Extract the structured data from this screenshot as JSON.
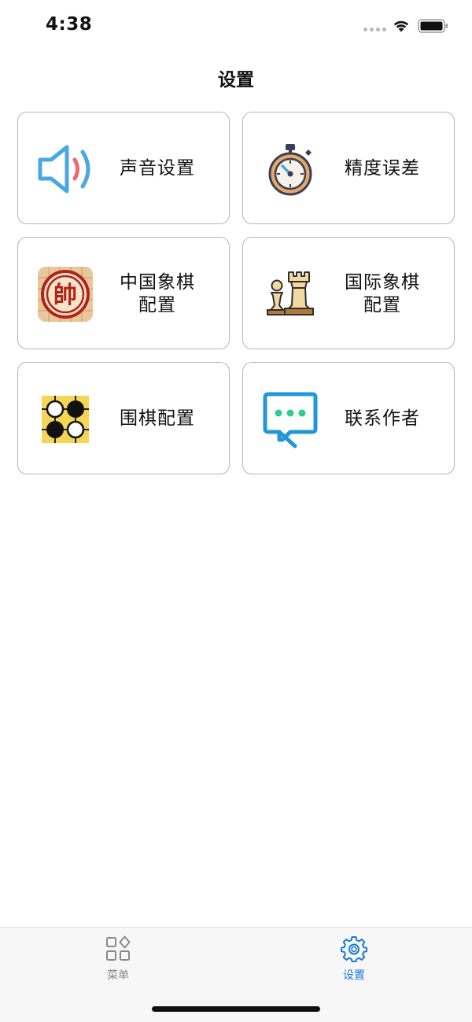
{
  "status_bar": {
    "time": "4:38"
  },
  "header": {
    "title": "设置"
  },
  "cards": [
    {
      "label_lines": [
        "声音设置"
      ],
      "icon": "speaker-icon"
    },
    {
      "label_lines": [
        "精度误差"
      ],
      "icon": "stopwatch-icon"
    },
    {
      "label_lines": [
        "中国象棋",
        "配置"
      ],
      "icon": "xiangqi-piece-icon",
      "icon_text": "帥"
    },
    {
      "label_lines": [
        "国际象棋",
        "配置"
      ],
      "icon": "chess-pieces-icon"
    },
    {
      "label_lines": [
        "围棋配置"
      ],
      "icon": "go-board-icon"
    },
    {
      "label_lines": [
        "联系作者"
      ],
      "icon": "chat-bubble-icon"
    }
  ],
  "tabbar": {
    "tabs": [
      {
        "label": "菜单",
        "icon": "grid-menu-icon",
        "active": false
      },
      {
        "label": "设置",
        "icon": "gear-icon",
        "active": true
      }
    ]
  },
  "colors": {
    "accent": "#1a7ad6",
    "inactive_tab": "#8a8a8a",
    "card_border": "#b5b5b5",
    "chat_dots": "#2ecc8f"
  }
}
